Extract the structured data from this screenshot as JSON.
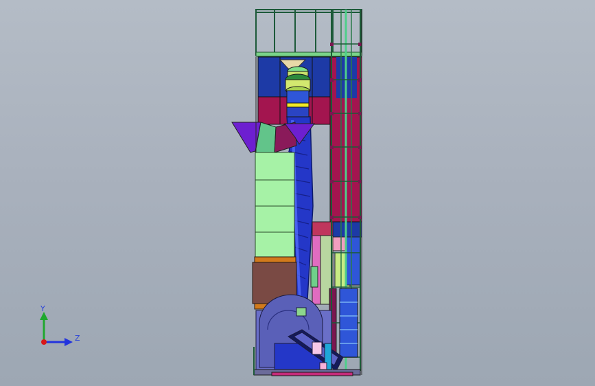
{
  "viewport": {
    "background_top": "#b4bcc6",
    "background_bottom": "#9da7b3"
  },
  "triad": {
    "y_label": "Y",
    "z_label": "Z",
    "y_color": "#1fa82e",
    "z_color": "#2233dd",
    "origin_color": "#d81818"
  },
  "model": {
    "description_icon": "cad-assembly-dryer-tower"
  }
}
